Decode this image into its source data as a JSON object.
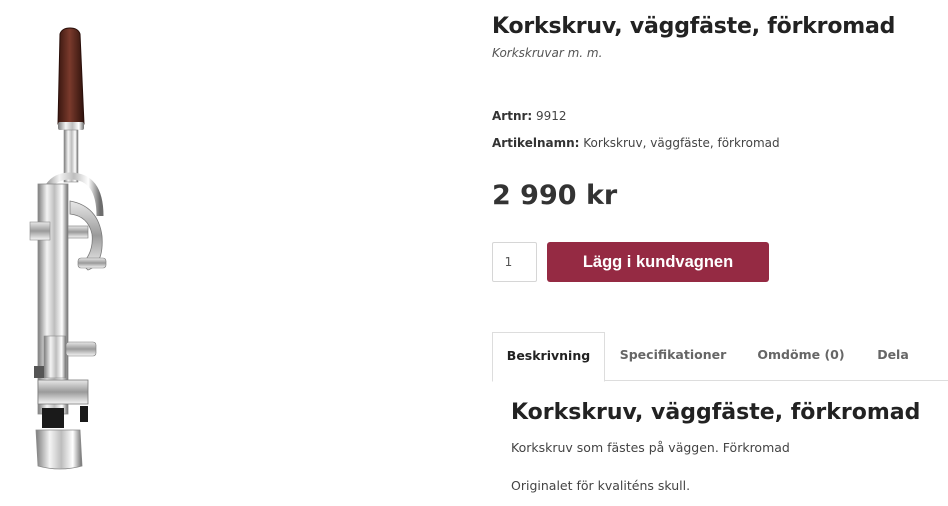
{
  "product": {
    "title": "Korkskruv, väggfäste, förkromad",
    "category": "Korkskruvar m. m.",
    "artnr_label": "Artnr:",
    "artnr_value": "9912",
    "name_label": "Artikelnamn:",
    "name_value": "Korkskruv, väggfäste, förkromad",
    "price": "2 990 kr",
    "image_icon": "wall-mounted-corkscrew-image"
  },
  "cart": {
    "quantity": "1",
    "button_label": "Lägg i kundvagnen",
    "button_color": "#952a43"
  },
  "tabs": [
    {
      "label": "Beskrivning",
      "active": true
    },
    {
      "label": "Specifikationer",
      "active": false
    },
    {
      "label": "Omdöme (0)",
      "active": false
    },
    {
      "label": "Dela",
      "active": false
    }
  ],
  "description": {
    "heading": "Korkskruv, väggfäste, förkromad",
    "paragraphs": [
      "Korkskruv som fästes på väggen. Förkromad",
      "Originalet för kvalitén​s skull."
    ]
  }
}
